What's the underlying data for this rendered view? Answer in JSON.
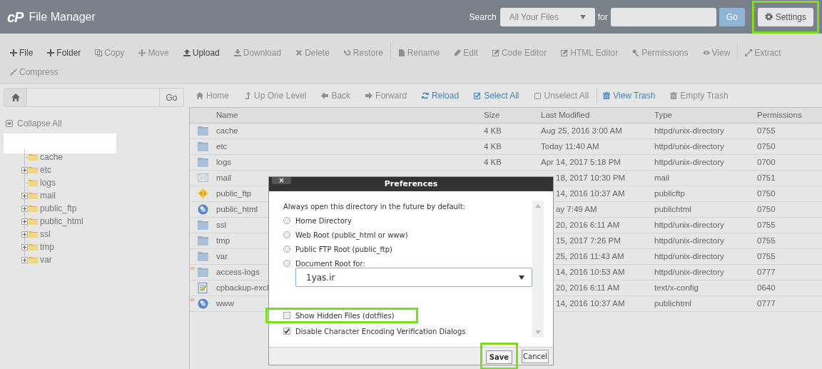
{
  "header": {
    "logo": "cP",
    "title": "File Manager",
    "search_label": "Search",
    "scope": "All Your Files",
    "for_label": "for",
    "go": "Go",
    "settings": {
      "label": "Settings",
      "highlighted": true
    }
  },
  "toolbar": [
    {
      "label": "File",
      "disabled": false
    },
    {
      "label": "Folder",
      "disabled": false
    },
    {
      "label": "Copy",
      "disabled": true
    },
    {
      "label": "Move",
      "disabled": true
    },
    {
      "label": "Upload",
      "disabled": false
    },
    {
      "label": "Download",
      "disabled": true
    },
    {
      "label": "Delete",
      "disabled": true
    },
    {
      "label": "Restore",
      "disabled": true
    },
    {
      "label": "Rename",
      "disabled": true
    },
    {
      "label": "Edit",
      "disabled": true
    },
    {
      "label": "Code Editor",
      "disabled": true
    },
    {
      "label": "HTML Editor",
      "disabled": true
    },
    {
      "label": "Permissions",
      "disabled": true
    },
    {
      "label": "View",
      "disabled": true
    },
    {
      "label": "Extract",
      "disabled": true
    },
    {
      "label": "Compress",
      "disabled": true
    }
  ],
  "path_bar": {
    "go": "Go"
  },
  "nav": [
    {
      "label": "Home",
      "disabled": true
    },
    {
      "label": "Up One Level",
      "disabled": true
    },
    {
      "label": "Back",
      "disabled": true
    },
    {
      "label": "Forward",
      "disabled": true
    },
    {
      "label": "Reload",
      "disabled": false
    },
    {
      "label": "Select All",
      "disabled": false
    },
    {
      "label": "Unselect All",
      "disabled": true
    },
    {
      "label": "View Trash",
      "disabled": false
    },
    {
      "label": "Empty Trash",
      "disabled": true
    }
  ],
  "tree": {
    "collapse_all": "Collapse All",
    "children": [
      {
        "label": "cache",
        "expandable": false
      },
      {
        "label": "etc",
        "expandable": true
      },
      {
        "label": "logs",
        "expandable": false
      },
      {
        "label": "mail",
        "expandable": true
      },
      {
        "label": "public_ftp",
        "expandable": true
      },
      {
        "label": "public_html",
        "expandable": true
      },
      {
        "label": "ssl",
        "expandable": true
      },
      {
        "label": "tmp",
        "expandable": true
      },
      {
        "label": "var",
        "expandable": true
      }
    ]
  },
  "table": {
    "columns": [
      "Name",
      "Size",
      "Last Modified",
      "Type",
      "Permissions"
    ],
    "rows": [
      {
        "kind": "folder",
        "name": "cache",
        "size": "4 KB",
        "modified": "Aug 25, 2016 3:00 AM",
        "type": "httpd/unix-directory",
        "permissions": "0755",
        "covered": false,
        "symlink": false
      },
      {
        "kind": "folder",
        "name": "etc",
        "size": "4 KB",
        "modified": "Today 11:40 AM",
        "type": "httpd/unix-directory",
        "permissions": "0750",
        "covered": false,
        "symlink": false
      },
      {
        "kind": "folder",
        "name": "logs",
        "size": "4 KB",
        "modified": "Apr 14, 2017 5:18 PM",
        "type": "httpd/unix-directory",
        "permissions": "0700",
        "covered": false,
        "symlink": false
      },
      {
        "kind": "mail",
        "name": "mail",
        "modified": "18, 2017 10:30 PM",
        "type": "mail",
        "permissions": "0751",
        "covered": true,
        "symlink": false
      },
      {
        "kind": "ftp",
        "name": "public_ftp",
        "modified": "14, 2016 10:37 AM",
        "type": "publicftp",
        "permissions": "0750",
        "covered": true,
        "symlink": false
      },
      {
        "kind": "globe",
        "name": "public_html",
        "modified": "ay 7:49 AM",
        "type": "publichtml",
        "permissions": "0750",
        "covered": true,
        "symlink": false
      },
      {
        "kind": "folder",
        "name": "ssl",
        "modified": "20, 2016 6:11 AM",
        "type": "httpd/unix-directory",
        "permissions": "0755",
        "covered": true,
        "symlink": false
      },
      {
        "kind": "folder",
        "name": "tmp",
        "modified": "15, 2017 7:26 PM",
        "type": "httpd/unix-directory",
        "permissions": "0755",
        "covered": true,
        "symlink": false
      },
      {
        "kind": "folder",
        "name": "var",
        "modified": "25, 2016 11:43 AM",
        "type": "httpd/unix-directory",
        "permissions": "0755",
        "covered": true,
        "symlink": false
      },
      {
        "kind": "folder",
        "name": "access-logs",
        "modified": "14, 2016 10:53 AM",
        "type": "httpd/unix-directory",
        "permissions": "0777",
        "covered": true,
        "symlink": true
      },
      {
        "kind": "config",
        "name": "cpbackup-excl",
        "modified": "20, 2016 6:11 AM",
        "type": "text/x-config",
        "permissions": "0640",
        "covered": true,
        "symlink": false
      },
      {
        "kind": "globe",
        "name": "www",
        "modified": "14, 2016 10:37 AM",
        "type": "publichtml",
        "permissions": "0777",
        "covered": true,
        "symlink": true
      }
    ]
  },
  "dialog": {
    "title": "Preferences",
    "close": "×",
    "prompt": "Always open this directory in the future by default:",
    "options": [
      {
        "label": "Home Directory",
        "selected": false
      },
      {
        "label": "Web Root (public_html or www)",
        "selected": false
      },
      {
        "label": "Public FTP Root (public_ftp)",
        "selected": false
      },
      {
        "label": "Document Root for:",
        "selected": false
      }
    ],
    "domain": "1yas.ir",
    "checkboxes": [
      {
        "label": "Show Hidden Files (dotfiles)",
        "checked": false,
        "highlighted": true
      },
      {
        "label": "Disable Character Encoding Verification Dialogs",
        "checked": true,
        "highlighted": false
      }
    ],
    "save": {
      "label": "Save",
      "highlighted": true
    },
    "cancel": "Cancel"
  }
}
